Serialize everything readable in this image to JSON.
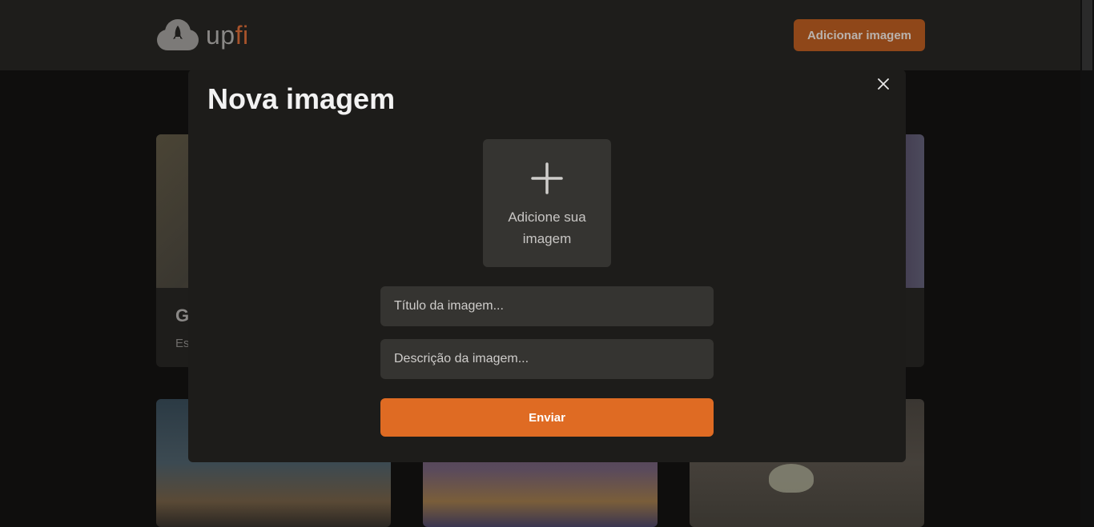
{
  "header": {
    "logo_up": "up",
    "logo_fi": "fi",
    "add_button_label": "Adicionar imagem"
  },
  "background_cards": {
    "first_title": "G",
    "first_description": "Es"
  },
  "modal": {
    "title": "Nova imagem",
    "close_icon": "close-icon",
    "upload_label": "Adicione sua imagem",
    "upload_icon": "plus-icon",
    "title_field_placeholder": "Título da imagem...",
    "description_field_placeholder": "Descrição da imagem...",
    "submit_label": "Enviar"
  },
  "colors": {
    "accent": "#df6b23",
    "header_button": "#8f4719",
    "modal_bg": "#1d1c1a",
    "field_bg": "#353431"
  }
}
